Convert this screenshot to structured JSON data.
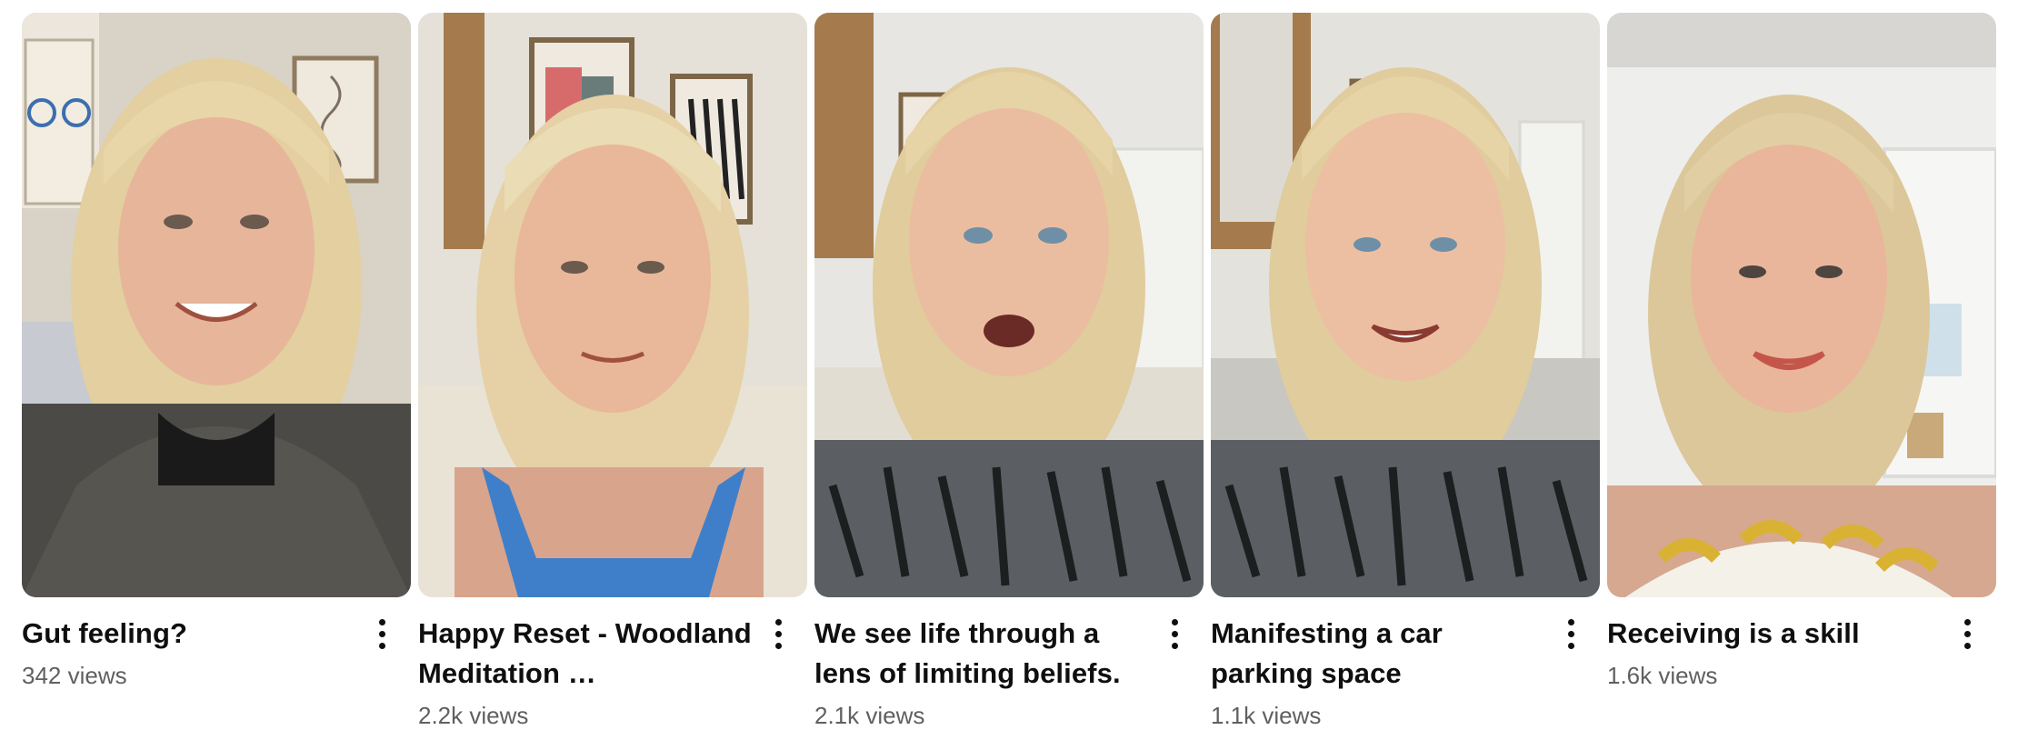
{
  "shelf": {
    "items": [
      {
        "title": "Gut feeling?",
        "views": "342 views",
        "menu_icon": "more-vert-icon"
      },
      {
        "title": "Happy Reset - Woodland Meditation …",
        "views": "2.2k views",
        "menu_icon": "more-vert-icon"
      },
      {
        "title": "We see life through a lens of limiting beliefs.",
        "views": "2.1k views",
        "menu_icon": "more-vert-icon"
      },
      {
        "title": "Manifesting a car parking space",
        "views": "1.1k views",
        "menu_icon": "more-vert-icon"
      },
      {
        "title": "Receiving is a skill",
        "views": "1.6k views",
        "menu_icon": "more-vert-icon"
      }
    ]
  },
  "colors": {
    "title": "#0f0f0f",
    "meta": "#606060",
    "background": "#ffffff"
  }
}
